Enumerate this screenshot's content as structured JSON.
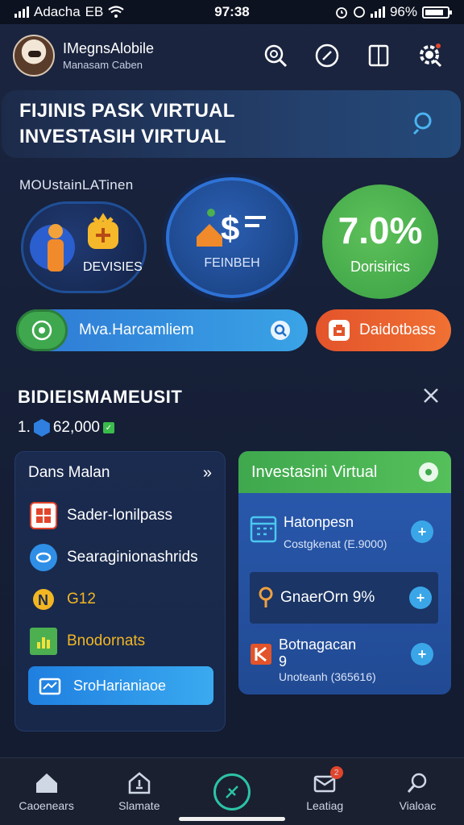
{
  "status_bar": {
    "carrier": "Adacha",
    "carrier_extra": "EB",
    "time": "97:38",
    "battery_percent": "96%"
  },
  "header": {
    "app_name": "IMegnsAlobile",
    "subtitle": "Manasam Caben"
  },
  "hero": {
    "line1": "FIJINIS PASK VIRTUAL",
    "line2": "INVESTASIH VIRTUAL"
  },
  "section_label": "MOUstainLATinen",
  "circles": [
    {
      "label": "DEVISIES"
    },
    {
      "label": "FEINBEH"
    },
    {
      "value": "7.0%",
      "label": "Dorisirics"
    }
  ],
  "pills": {
    "primary_label": "Mva.Harcamliem",
    "secondary_label": "Daidotbass"
  },
  "balance": {
    "title": "BIDIEISMAMEUSIT",
    "prefix": "1.",
    "amount": "62,000"
  },
  "left_panel": {
    "title": "Dans Malan",
    "items": [
      {
        "label": "Sader-lonilpass",
        "icon": "grid-icon",
        "color": "#e2452b"
      },
      {
        "label": "Searaginionashrids",
        "icon": "chat-icon",
        "color": "#2f8fe6"
      },
      {
        "label": "G12",
        "icon": "coin-icon",
        "color": "#f2b623"
      },
      {
        "label": "Bnodornats",
        "icon": "chart-icon",
        "color": "#4caf50"
      }
    ],
    "active_item": {
      "label": "SroHarianiaoe",
      "icon": "folder-icon"
    }
  },
  "right_panel": {
    "title": "Investasini Virtual",
    "rows": [
      {
        "title": "Hatonpesn",
        "detail": "Costgkenat (E.9000)",
        "icon": "calendar-icon"
      },
      {
        "title": "GnaerOrn 9%",
        "detail": "",
        "icon": "key-icon"
      },
      {
        "title": "Botnagacan",
        "title2": "9",
        "detail": "Unoteanh (365616)",
        "icon": "orange-k-icon"
      }
    ]
  },
  "bottom_nav": [
    {
      "label": "Caoenears",
      "icon": "home-icon"
    },
    {
      "label": "Slamate",
      "icon": "calculator-icon"
    },
    {
      "label": "",
      "icon": "compass-icon"
    },
    {
      "label": "Leatiag",
      "icon": "mail-icon",
      "badge": "2"
    },
    {
      "label": "Vialoac",
      "icon": "search-icon"
    }
  ],
  "colors": {
    "accent_blue": "#2e79d4",
    "accent_green": "#3fa84e",
    "accent_orange": "#e3542b",
    "teal": "#2cc3a6"
  }
}
